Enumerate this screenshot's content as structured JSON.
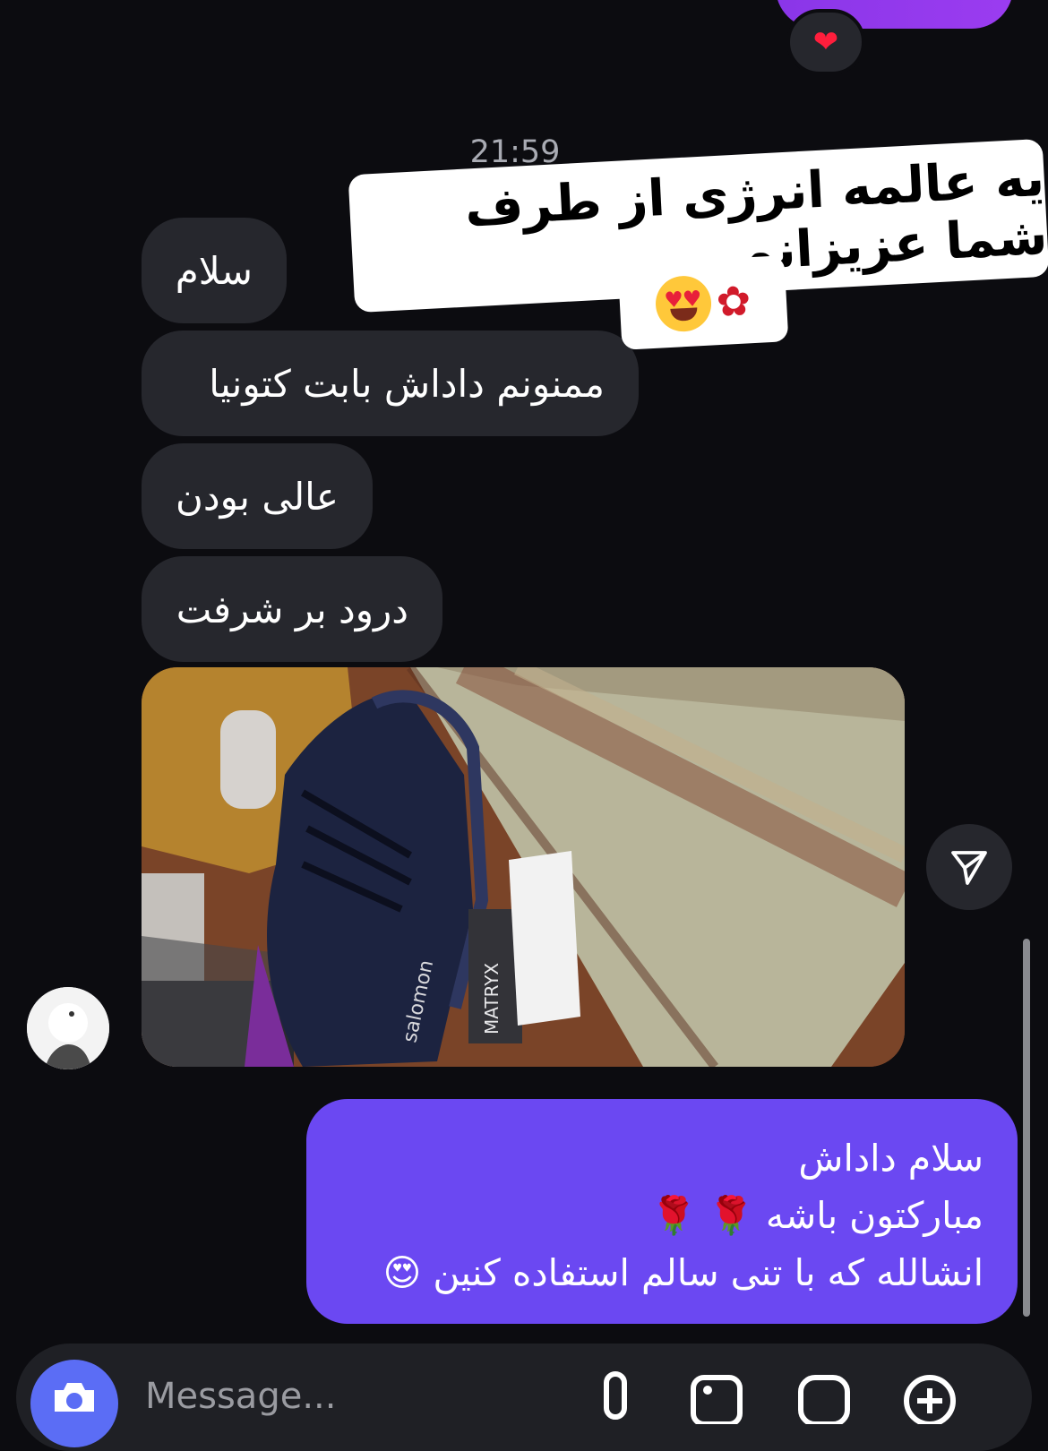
{
  "chat": {
    "reaction_icon": "heart-icon",
    "timestamp": "21:59",
    "incoming": [
      "سلام",
      "ممنونم داداش بابت کتونیا",
      "عالی بودن",
      "درود بر شرفت"
    ],
    "sticker_text": "یه عالمه انرژی از طرف شما عزیزانم",
    "photo_labels": {
      "brand": "salomon",
      "tag": "MATRYX"
    },
    "outgoing_lines": [
      "سلام داداش",
      "مبارکتون باشه 🌹 🌹",
      "انشالله که با تنی سالم استفاده کنین 😍"
    ]
  },
  "composer": {
    "placeholder": "Message..."
  },
  "colors": {
    "incoming_bubble": "#26272d",
    "outgoing_bubble": "#6b48f2",
    "top_bubble": "#9b3cf0",
    "camera_button": "#5b6df5"
  }
}
